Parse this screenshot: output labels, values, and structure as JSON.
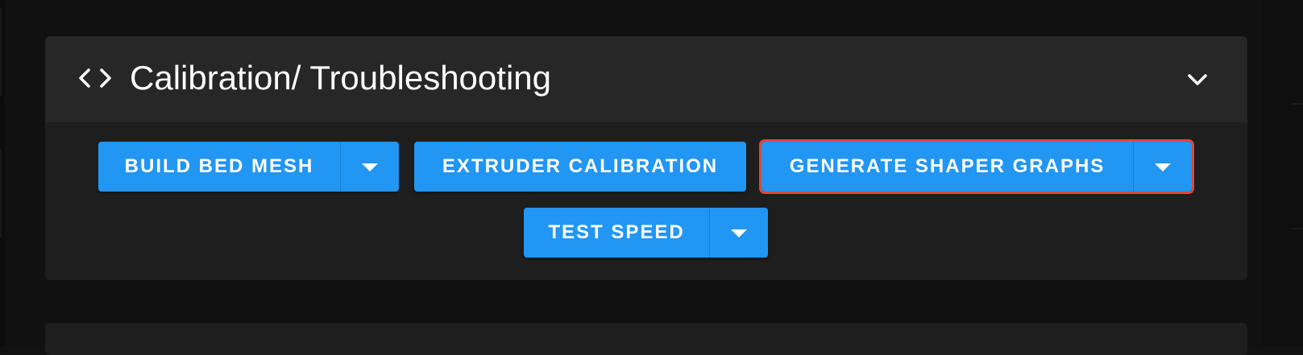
{
  "panel": {
    "title": "Calibration/ Troubleshooting",
    "header_icon": "code-brackets-icon",
    "toggle_icon": "chevron-down-icon",
    "expanded": true
  },
  "buttons": [
    {
      "label": "BUILD BED MESH",
      "has_menu": true,
      "menu_icon": "caret-down-icon"
    },
    {
      "label": "EXTRUDER CALIBRATION",
      "has_menu": false
    },
    {
      "label": "GENERATE SHAPER GRAPHS",
      "has_menu": true,
      "menu_icon": "caret-down-icon",
      "highlighted": true
    },
    {
      "label": "TEST SPEED",
      "has_menu": true,
      "menu_icon": "caret-down-icon"
    }
  ],
  "colors": {
    "page_background": "#121212",
    "card_background": "#1e1e1e",
    "header_background": "#272727",
    "button_primary": "#2196f3",
    "highlight_outline": "#e0463a",
    "text": "#ffffff"
  }
}
